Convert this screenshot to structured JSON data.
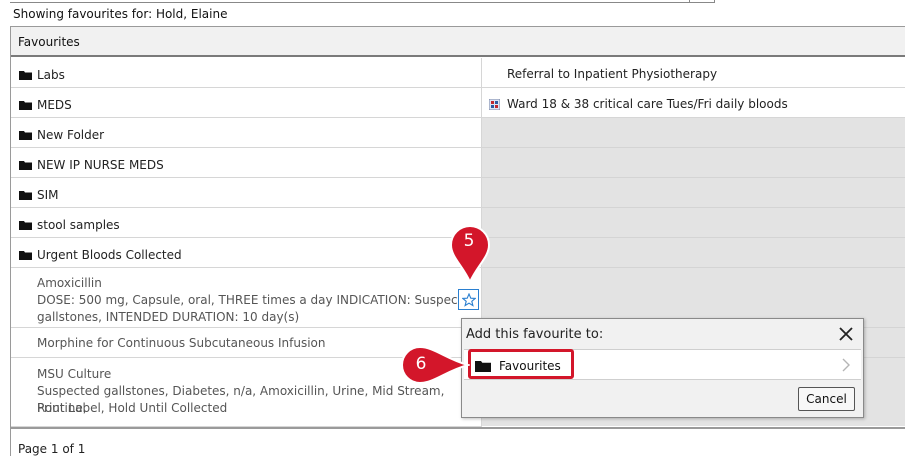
{
  "header": {
    "showing_text": "Showing favourites for: Hold, Elaine",
    "panel_title": "Favourites"
  },
  "left_items": [
    {
      "label": "Labs",
      "type": "folder"
    },
    {
      "label": "MEDS",
      "type": "folder"
    },
    {
      "label": "New Folder",
      "type": "folder"
    },
    {
      "label": "NEW IP NURSE MEDS",
      "type": "folder"
    },
    {
      "label": "SIM",
      "type": "folder"
    },
    {
      "label": "stool samples",
      "type": "folder"
    },
    {
      "label": "Urgent Bloods Collected",
      "type": "folder"
    }
  ],
  "orders": [
    {
      "name": "Amoxicillin",
      "details_line1": "DOSE: 500 mg, Capsule, oral, THREE times a day INDICATION: Suspected",
      "details_line2": "gallstones, INTENDED DURATION: 10 day(s)"
    },
    {
      "name": "Morphine for Continuous Subcutaneous Infusion"
    },
    {
      "name": "MSU Culture",
      "details_line1": "Suspected gallstones, Diabetes, n/a, Amoxicillin, Urine, Mid Stream, Routine,",
      "details_line2": "Print Label, Hold Until Collected"
    }
  ],
  "right_items": [
    {
      "label": "Referral to Inpatient Physiotherapy"
    },
    {
      "label": "Ward 18 & 38 critical care Tues/Fri daily bloods"
    }
  ],
  "footer": {
    "page_text": "Page 1 of 1"
  },
  "popup": {
    "title": "Add this favourite to:",
    "item_label": "Favourites",
    "cancel_label": "Cancel"
  },
  "markers": {
    "step5": "5",
    "step6": "6"
  },
  "icons": {
    "folder": "folder-icon",
    "star": "star-outline-icon",
    "close": "close-icon",
    "chevron": "chevron-right-icon",
    "order_set": "order-set-icon"
  },
  "colors": {
    "annotation_red": "#d3162a",
    "star_blue": "#2a7fd0"
  }
}
